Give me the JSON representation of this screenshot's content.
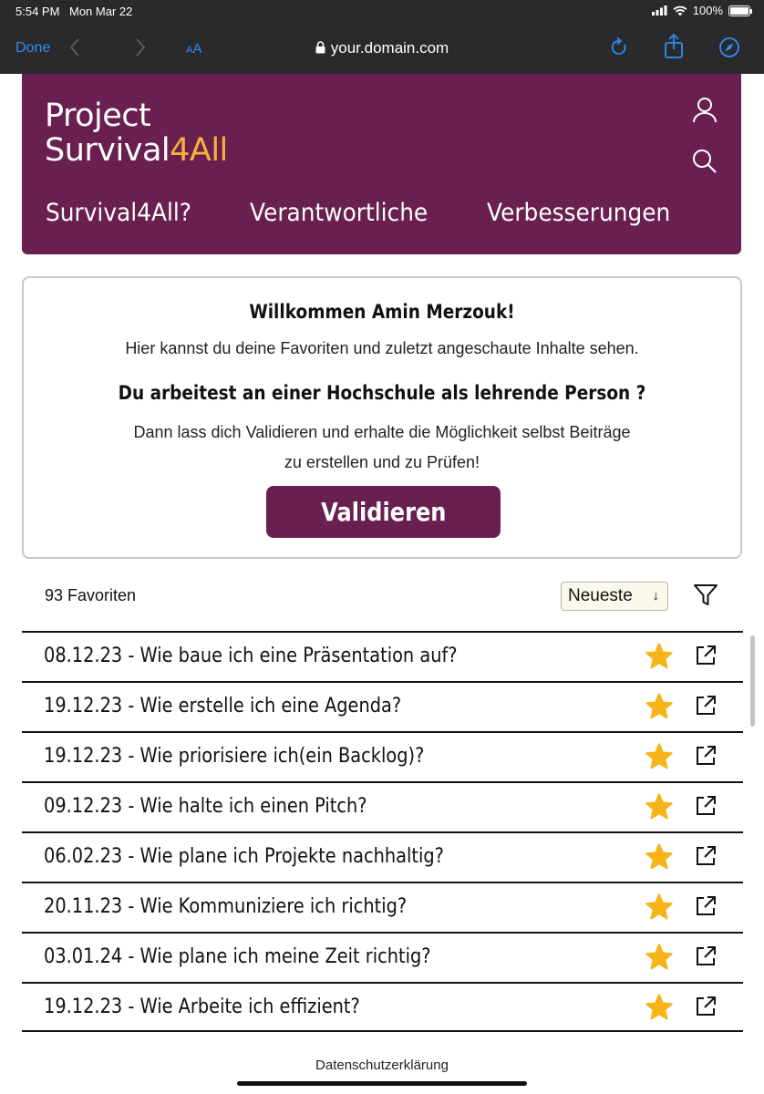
{
  "status_bar": {
    "time": "5:54 PM",
    "date": "Mon Mar 22",
    "battery": "100%"
  },
  "browser": {
    "done_label": "Done",
    "text_size_label": "AA",
    "url": "your.domain.com"
  },
  "site": {
    "logo_line1": "Project",
    "logo_line2_a": "Survival",
    "logo_line2_b": "4All",
    "accent_color": "#f4b23a",
    "brand_color": "#6a1f51",
    "nav": [
      "Survival4All?",
      "Verantwortliche",
      "Verbesserungen"
    ]
  },
  "welcome": {
    "title": "Willkommen Amin Merzouk!",
    "subtitle": "Hier kannst du deine Favoriten und zuletzt angeschaute Inhalte sehen.",
    "question": "Du arbeitest an einer Hochschule als lehrende Person ?",
    "body_line1": "Dann lass dich Validieren und erhalte die Möglichkeit selbst Beiträge",
    "body_line2": "zu erstellen und zu Prüfen!",
    "button_label": "Validieren"
  },
  "favorites": {
    "count_label": "93 Favoriten",
    "sort_label": "Neueste",
    "items": [
      "08.12.23 - Wie baue ich eine Präsentation auf?",
      "19.12.23 - Wie erstelle ich eine Agenda?",
      "19.12.23 - Wie priorisiere ich(ein Backlog)?",
      "09.12.23 - Wie halte ich einen Pitch?",
      "06.02.23 - Wie plane ich Projekte nachhaltig?",
      "20.11.23 - Wie Kommuniziere ich richtig?",
      "03.01.24 - Wie plane ich meine Zeit richtig?",
      "19.12.23 - Wie Arbeite ich effizient?"
    ]
  },
  "footer": {
    "privacy_label": "Datenschutzerklärung"
  }
}
